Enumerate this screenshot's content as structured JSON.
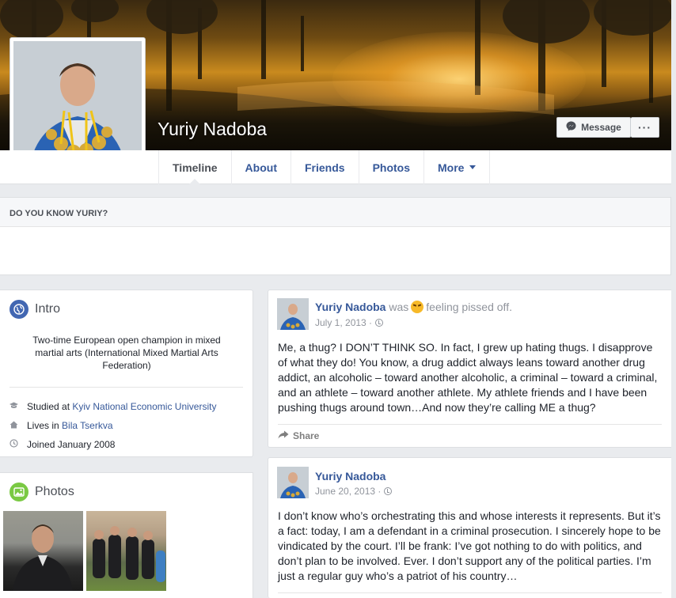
{
  "profile": {
    "name": "Yuriy Nadoba",
    "message_label": "Message",
    "more_actions": "···"
  },
  "nav": {
    "tabs": [
      {
        "label": "Timeline"
      },
      {
        "label": "About"
      },
      {
        "label": "Friends"
      },
      {
        "label": "Photos"
      },
      {
        "label": "More"
      }
    ]
  },
  "know": {
    "title": "DO YOU KNOW YURIY?"
  },
  "intro": {
    "title": "Intro",
    "bio": "Two-time European open champion in mixed martial arts (International Mixed Martial Arts Federation)",
    "studied_prefix": "Studied at",
    "studied_link": "Kyiv National Economic University",
    "lives_prefix": "Lives in",
    "lives_link": "Bila Tserkva",
    "joined": "Joined January 2008"
  },
  "photos_card": {
    "title": "Photos"
  },
  "posts": [
    {
      "author": "Yuriy Nadoba",
      "was": "was",
      "feeling": "feeling pissed off.",
      "date": "July 1, 2013 · ",
      "text": "Me, a thug? I DON’T THINK SO. In fact, I grew up hating thugs. I disapprove of what they do! You know, a drug addict always leans toward another drug addict, an alcoholic – toward another alcoholic, a criminal – toward a criminal, and an athlete – toward another athlete. My athlete friends and I have been pushing thugs around town…And now they’re calling ME a thug?",
      "share": "Share"
    },
    {
      "author": "Yuriy Nadoba",
      "date": "June 20, 2013 · ",
      "text": "I don’t know who’s orchestrating this and whose interests it represents. But it’s a fact: today, I am a defendant in a criminal prosecution. I sincerely hope to be vindicated by the court. I’ll be frank: I’ve got nothing to do with politics, and don’t plan to be involved. Ever. I don’t support any of the political parties. I’m just a regular guy who’s a patriot of his country…"
    }
  ],
  "colors": {
    "link": "#365899",
    "intro_icon": "#4267b2",
    "photos_icon": "#7ac943",
    "background": "#e9ebee"
  },
  "icons": [
    "messenger-icon",
    "globe-icon",
    "photo-icon",
    "graduation-cap-icon",
    "house-icon",
    "clock-icon",
    "share-icon",
    "privacy-globe-icon",
    "angry-emoji-icon"
  ]
}
